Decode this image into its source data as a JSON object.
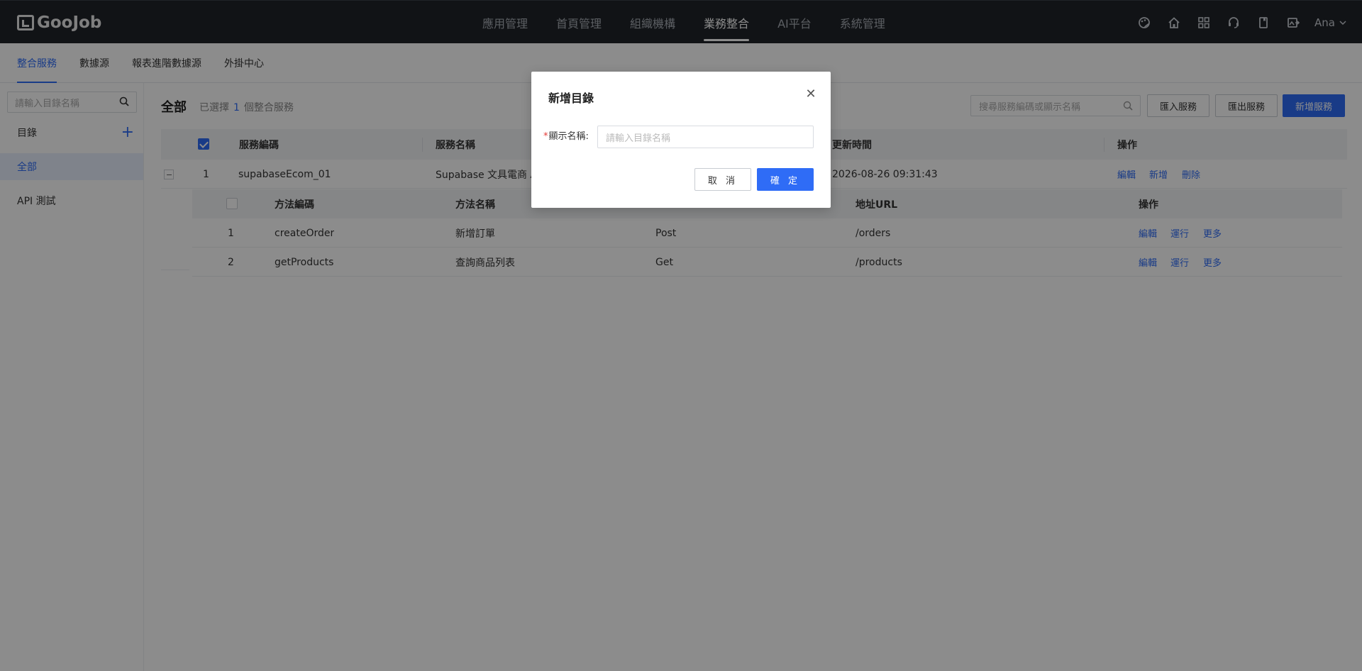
{
  "app": {
    "logo_text": "GooJob"
  },
  "nav": {
    "items": [
      {
        "label": "應用管理",
        "active": false
      },
      {
        "label": "首頁管理",
        "active": false
      },
      {
        "label": "組織機構",
        "active": false
      },
      {
        "label": "業務整合",
        "active": true
      },
      {
        "label": "AI平台",
        "active": false
      },
      {
        "label": "系統管理",
        "active": false
      }
    ],
    "user": "Ana"
  },
  "subtabs": [
    {
      "label": "整合服務",
      "active": true
    },
    {
      "label": "數據源",
      "active": false
    },
    {
      "label": "報表進階數據源",
      "active": false
    },
    {
      "label": "外掛中心",
      "active": false
    }
  ],
  "sidebar": {
    "search_placeholder": "請輸入目錄名稱",
    "header": "目錄",
    "items": [
      {
        "label": "全部",
        "active": true
      },
      {
        "label": "API 測試",
        "active": false
      }
    ]
  },
  "main": {
    "title": "全部",
    "selected_prefix": "已選擇",
    "selected_count": "1",
    "selected_suffix": "個整合服務",
    "search_placeholder": "搜尋服務編碼或顯示名稱",
    "import_label": "匯入服務",
    "export_label": "匯出服務",
    "new_label": "新增服務",
    "columns": {
      "code": "服務編碼",
      "name": "服務名稱",
      "updated": "更新時間",
      "ops": "操作"
    },
    "rows": [
      {
        "index": "1",
        "code": "supabaseEcom_01",
        "name": "Supabase 文具電商 A",
        "updated": "2026-08-26 09:31:43",
        "ops": [
          "編輯",
          "新增",
          "刪除"
        ]
      }
    ],
    "method_columns": {
      "code": "方法編碼",
      "name": "方法名稱",
      "url": "地址URL",
      "ops": "操作"
    },
    "methods": [
      {
        "index": "1",
        "code": "createOrder",
        "name": "新增訂單",
        "type": "Post",
        "url": "/orders",
        "ops": [
          "編輯",
          "運行",
          "更多"
        ]
      },
      {
        "index": "2",
        "code": "getProducts",
        "name": "查詢商品列表",
        "type": "Get",
        "url": "/products",
        "ops": [
          "編輯",
          "運行",
          "更多"
        ]
      }
    ]
  },
  "modal": {
    "title": "新增目錄",
    "required_mark": "*",
    "field_label": "顯示名稱:",
    "field_placeholder": "請輸入目錄名稱",
    "cancel_label": "取 消",
    "ok_label": "確 定"
  },
  "colors": {
    "primary": "#2f6cf6",
    "topbar": "#1f2329"
  }
}
